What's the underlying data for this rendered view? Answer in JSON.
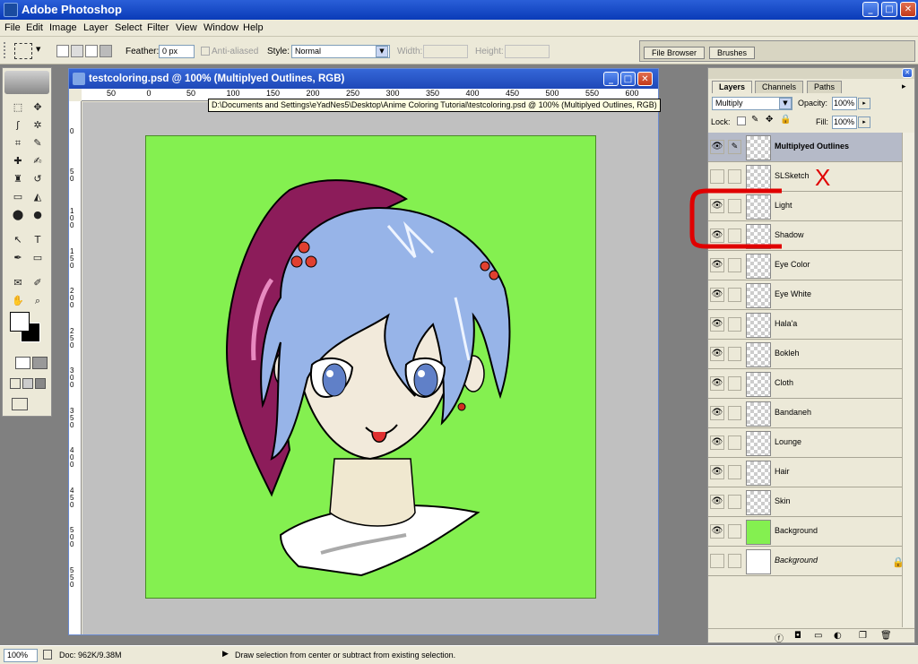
{
  "app": {
    "title": "Adobe Photoshop",
    "controls": {
      "minimize": "_",
      "maximize": "□",
      "close": "✕"
    }
  },
  "menu": {
    "items": [
      "File",
      "Edit",
      "Image",
      "Layer",
      "Select",
      "Filter",
      "View",
      "Window",
      "Help"
    ]
  },
  "options_bar": {
    "feather_label": "Feather:",
    "feather_value": "0 px",
    "antialiased_label": "Anti-aliased",
    "style_label": "Style:",
    "style_value": "Normal",
    "width_label": "Width:",
    "height_label": "Height:",
    "palette_tabs": [
      "File Browser",
      "Brushes"
    ]
  },
  "toolbox": {
    "tools": [
      "marquee-tool",
      "move-tool",
      "lasso-tool",
      "magic-wand-tool",
      "crop-tool",
      "slice-tool",
      "healing-brush-tool",
      "brush-tool",
      "clone-stamp-tool",
      "history-brush-tool",
      "eraser-tool",
      "gradient-tool",
      "blur-tool",
      "dodge-tool",
      "path-selection-tool",
      "type-tool",
      "pen-tool",
      "shape-tool",
      "notes-tool",
      "eyedropper-tool",
      "hand-tool",
      "zoom-tool"
    ],
    "glyphs": [
      "⬚",
      "✥",
      "ʃ",
      "✲",
      "⌗",
      "✎",
      "✚",
      "✍",
      "♜",
      "↺",
      "▭",
      "◭",
      "⬤",
      "●",
      "↖",
      "T",
      "✒",
      "▭",
      "✉",
      "✐",
      "✋",
      "⌕"
    ]
  },
  "document": {
    "title": "testcoloring.psd @ 100% (Multiplyed Outlines, RGB)",
    "tooltip": "D:\\Documents and Settings\\eYadNes5\\Desktop\\Anime Coloring Tutorial\\testcoloring.psd @ 100% (Multiplyed Outlines, RGB)",
    "ruler_h": [
      "50",
      "0",
      "50",
      "100",
      "150",
      "200",
      "250",
      "300",
      "350",
      "400",
      "450",
      "500",
      "550",
      "600"
    ],
    "ruler_v": [
      "0",
      "5\n0",
      "1\n0\n0",
      "1\n5\n0",
      "2\n0\n0",
      "2\n5\n0",
      "3\n0\n0",
      "3\n5\n0",
      "4\n0\n0",
      "4\n5\n0",
      "5\n0\n0",
      "5\n5\n0"
    ],
    "canvas_color": "#84f050"
  },
  "layers_panel": {
    "tabs": [
      "Layers",
      "Channels",
      "Paths"
    ],
    "blend_mode": "Multiply",
    "opacity_label": "Opacity:",
    "opacity_value": "100%",
    "lock_label": "Lock:",
    "fill_label": "Fill:",
    "fill_value": "100%",
    "layers": [
      {
        "name": "Multiplyed Outlines",
        "visible": true,
        "selected": true
      },
      {
        "name": "SLSketch",
        "visible": false,
        "selected": false
      },
      {
        "name": "Light",
        "visible": true,
        "selected": false
      },
      {
        "name": "Shadow",
        "visible": true,
        "selected": false
      },
      {
        "name": "Eye Color",
        "visible": true,
        "selected": false
      },
      {
        "name": "Eye White",
        "visible": true,
        "selected": false
      },
      {
        "name": "Hala'a",
        "visible": true,
        "selected": false
      },
      {
        "name": "Bokleh",
        "visible": true,
        "selected": false
      },
      {
        "name": "Cloth",
        "visible": true,
        "selected": false
      },
      {
        "name": "Bandaneh",
        "visible": true,
        "selected": false
      },
      {
        "name": "Lounge",
        "visible": true,
        "selected": false
      },
      {
        "name": "Hair",
        "visible": true,
        "selected": false
      },
      {
        "name": "Skin",
        "visible": true,
        "selected": false
      },
      {
        "name": "Background",
        "visible": true,
        "selected": false
      },
      {
        "name": "Background",
        "visible": false,
        "selected": false
      }
    ],
    "annotation_x": "X"
  },
  "status": {
    "zoom": "100%",
    "doc_info": "Doc: 962K/9.38M",
    "hint": "Draw selection from center or subtract from existing selection."
  }
}
